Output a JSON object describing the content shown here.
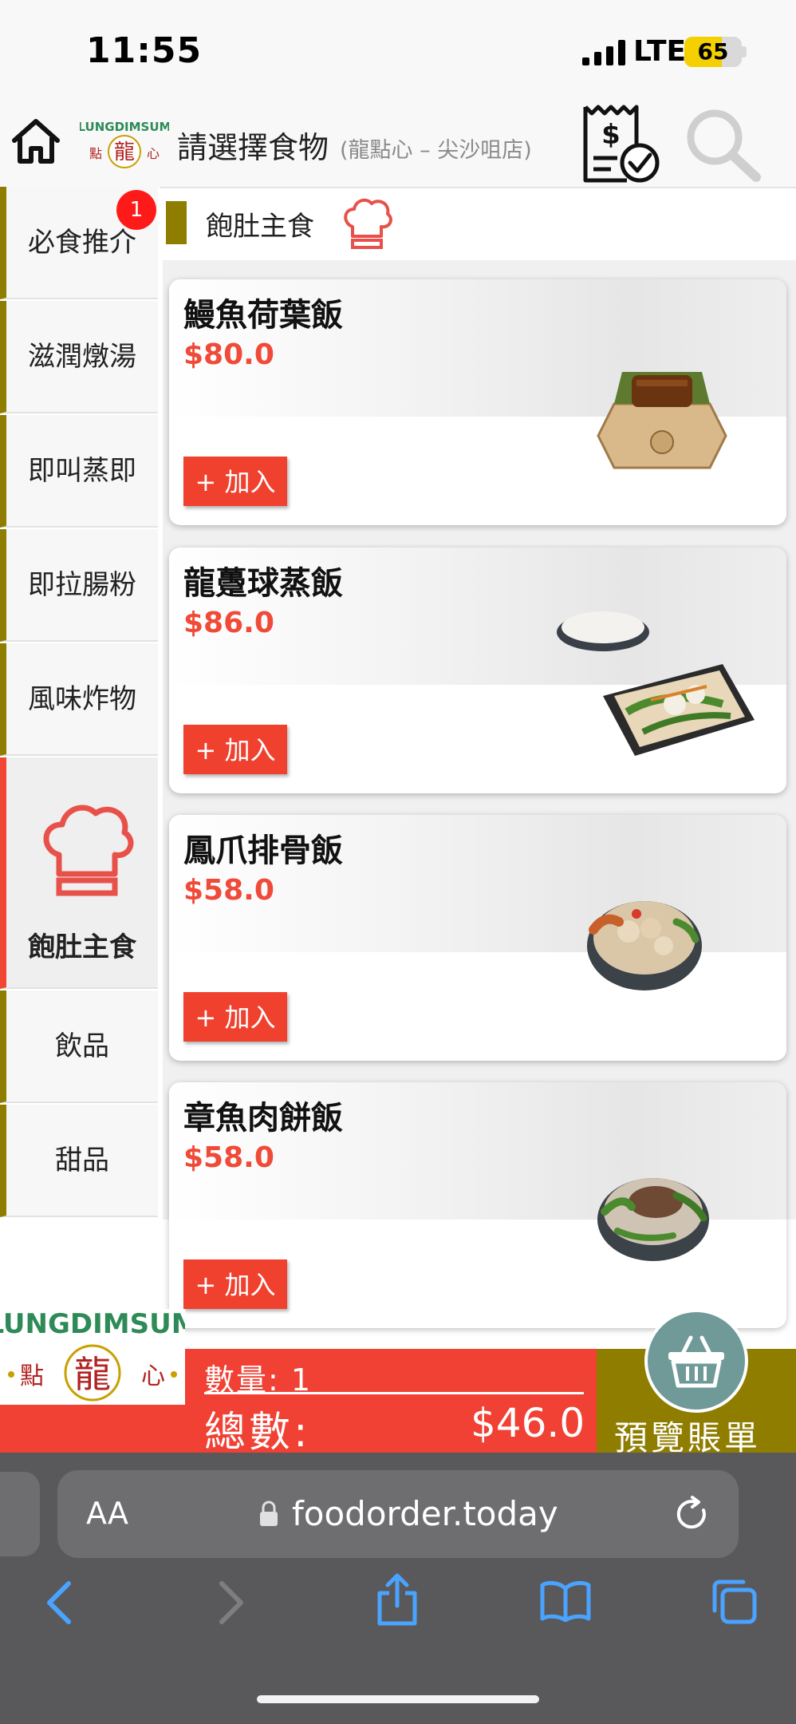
{
  "status_bar": {
    "time": "11:55",
    "network": "LTE",
    "battery_level": 65,
    "battery_text": "65"
  },
  "header": {
    "logo_text": "LUNGDIMSUM",
    "title": "請選擇食物",
    "subtitle": "(龍點心 – 尖沙咀店)",
    "icons": [
      "home-icon",
      "bill-icon",
      "search-icon"
    ]
  },
  "sidebar": {
    "badge_count": "1",
    "items": [
      {
        "label": "必食推介"
      },
      {
        "label": "滋潤燉湯"
      },
      {
        "label": "即叫蒸即"
      },
      {
        "label": "即拉腸粉"
      },
      {
        "label": "風味炸物"
      },
      {
        "label": "飽肚主食",
        "active": true
      },
      {
        "label": "飲品"
      },
      {
        "label": "甜品"
      }
    ]
  },
  "section": {
    "title": "飽肚主食",
    "icon": "chef-hat-icon"
  },
  "foods": [
    {
      "name": "鰻魚荷葉飯",
      "price": "$80.0",
      "add_label": "+ 加入"
    },
    {
      "name": "龍躉球蒸飯",
      "price": "$86.0",
      "add_label": "+ 加入"
    },
    {
      "name": "鳳爪排骨飯",
      "price": "$58.0",
      "add_label": "+ 加入"
    },
    {
      "name": "章魚肉餅飯",
      "price": "$58.0",
      "add_label": "+ 加入"
    }
  ],
  "order_bar": {
    "logo_text": "LUNGDIMSUM",
    "quantity_label": "數量: 1",
    "total_label": "總數:",
    "total_value": "$46.0",
    "preview_label": "預覽賬單",
    "basket_icon": "basket-icon"
  },
  "browser": {
    "aa_label": "AA",
    "url": "foodorder.today",
    "icons": [
      "lock-icon",
      "reload-icon",
      "back-icon",
      "forward-icon",
      "share-icon",
      "bookmarks-icon",
      "tabs-icon"
    ]
  },
  "colors": {
    "accent_red": "#f04134",
    "brand_gold": "#8f7d00",
    "price_red": "#f04a38"
  }
}
